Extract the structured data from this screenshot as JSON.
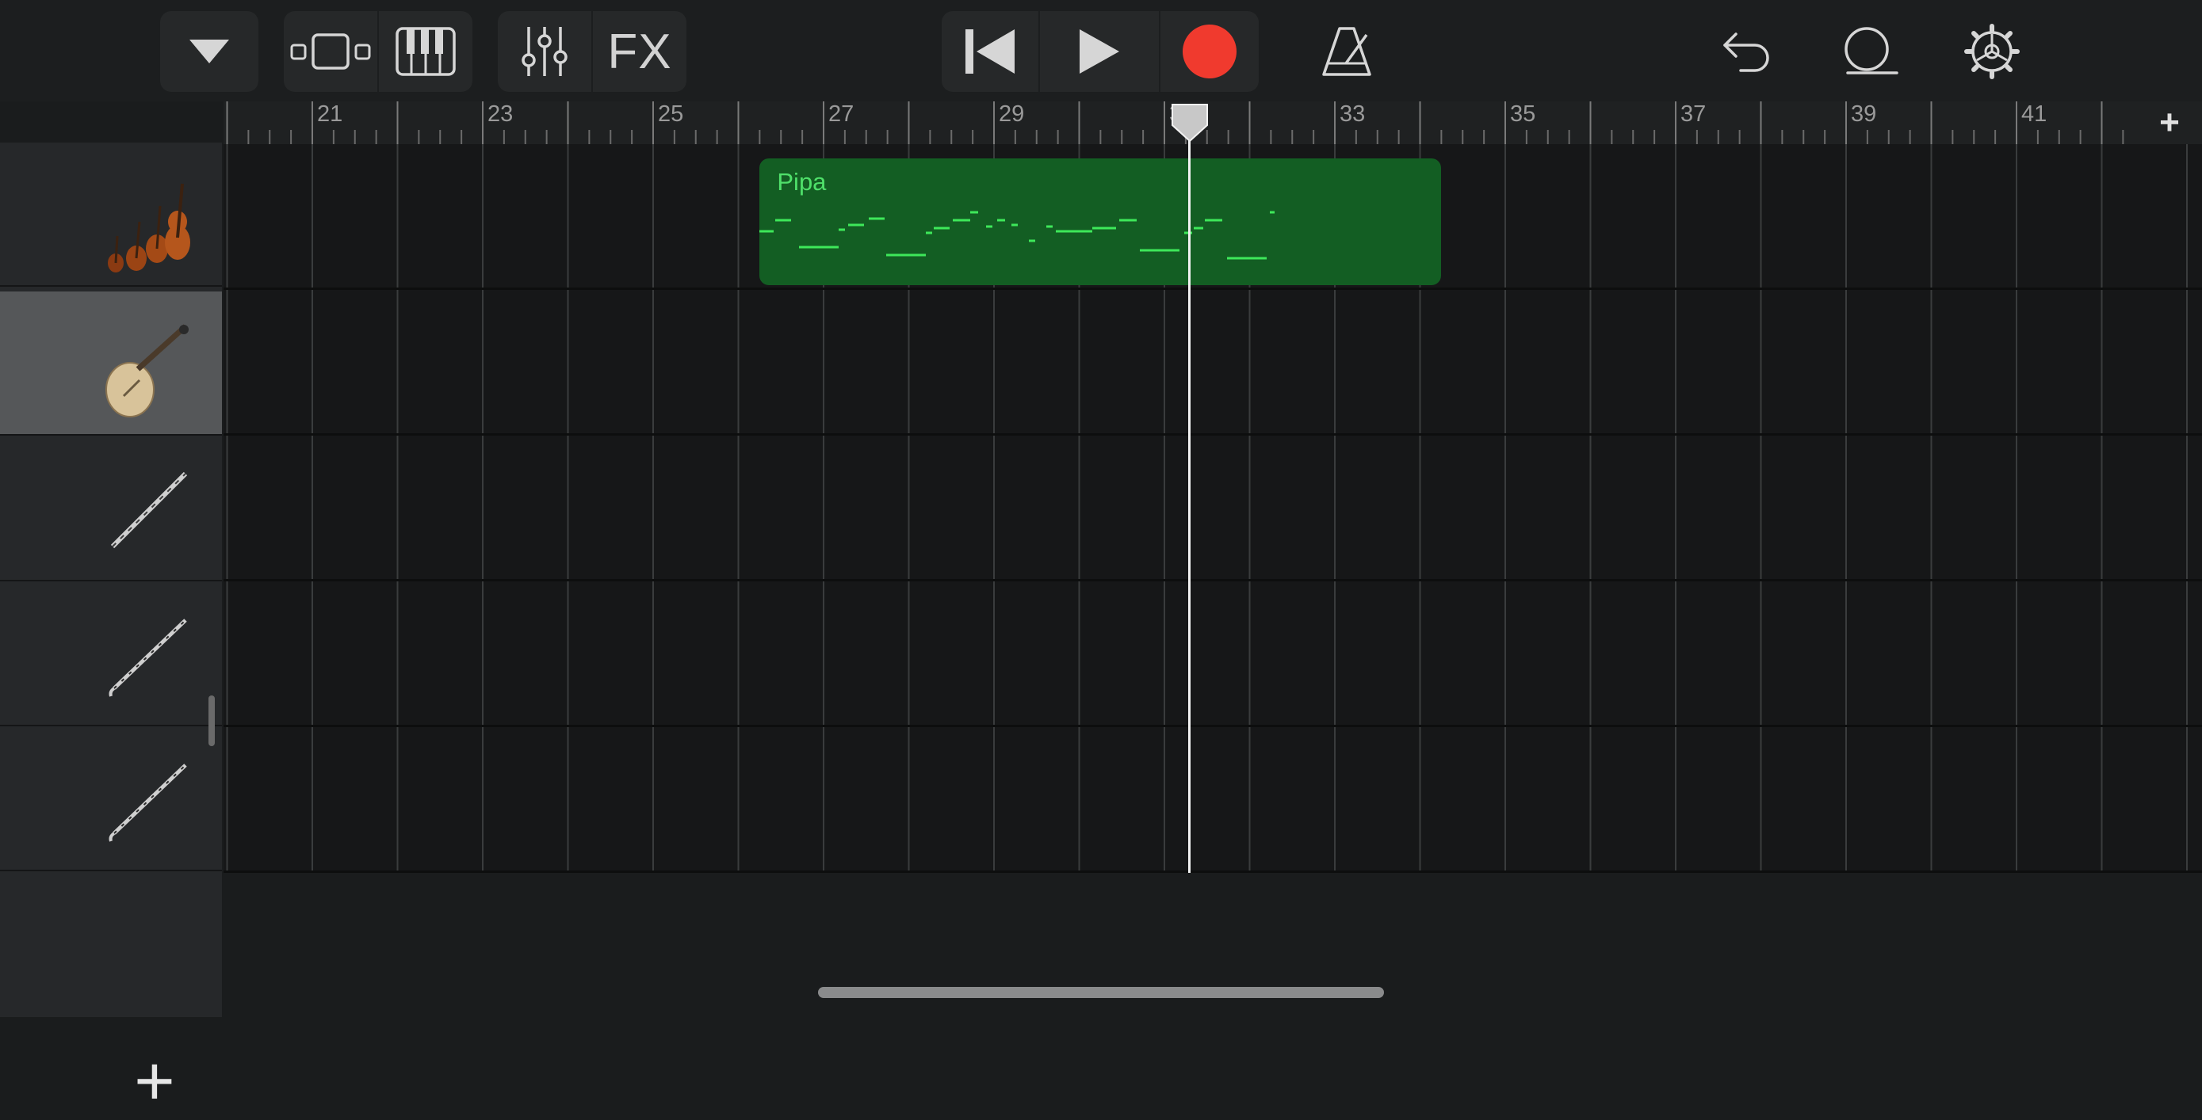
{
  "toolbar": {
    "browser_menu": "chevron-down-icon",
    "view_buttons": [
      "tracks-view-icon",
      "keyboard-icon"
    ],
    "mix_buttons": [
      "mixer-icon",
      "FX"
    ],
    "transport": [
      "go-to-beginning-icon",
      "play-icon",
      "record-icon"
    ],
    "right_buttons": [
      "metronome-icon",
      "undo-icon",
      "loop-icon",
      "settings-icon"
    ],
    "record_color": "#f03a2e"
  },
  "ruler": {
    "bar_numbers": [
      "21",
      "23",
      "25",
      "27",
      "29",
      "31",
      "33",
      "35",
      "37",
      "39",
      "41"
    ],
    "playhead_bar": "31",
    "add_section": "+"
  },
  "tracks": [
    {
      "instrument": "strings",
      "icon": "violin-family-icon",
      "selected": false
    },
    {
      "instrument": "pipa",
      "icon": "pipa-icon",
      "selected": true
    },
    {
      "instrument": "dizi",
      "icon": "flute-icon",
      "selected": false
    },
    {
      "instrument": "clarinet",
      "icon": "clarinet-icon",
      "selected": false
    },
    {
      "instrument": "clarinet",
      "icon": "clarinet-icon",
      "selected": false
    }
  ],
  "region": {
    "name": "Pipa",
    "color": "#135e23",
    "label_color": "#4fe06a",
    "start_bar": 26.25,
    "end_bar": 34.25
  },
  "add_track": "+"
}
